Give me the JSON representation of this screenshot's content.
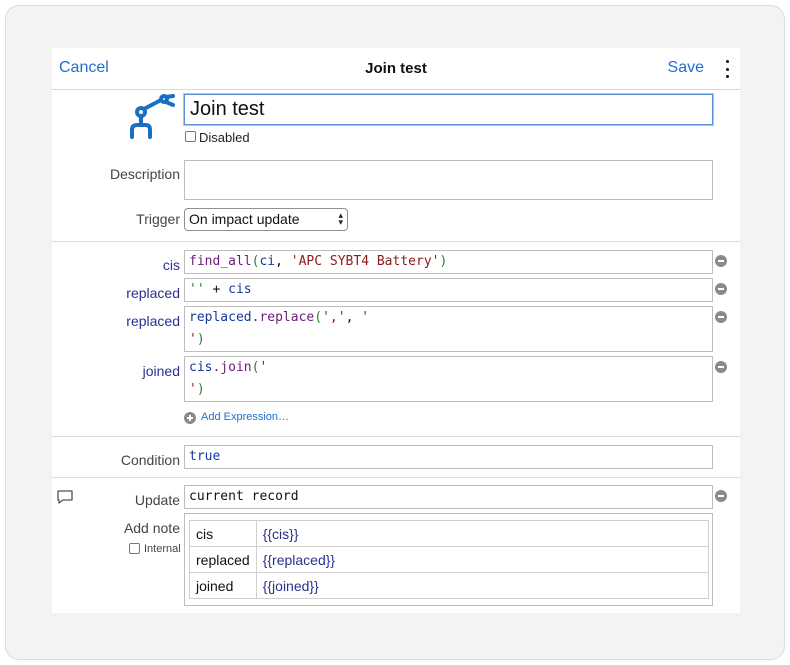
{
  "header": {
    "cancel_label": "Cancel",
    "title": "Join test",
    "save_label": "Save"
  },
  "identity": {
    "name_value": "Join test",
    "disabled_label": "Disabled"
  },
  "description": {
    "label": "Description",
    "value": ""
  },
  "trigger": {
    "label": "Trigger",
    "selected": "On impact update"
  },
  "expressions": [
    {
      "name": "cis"
    },
    {
      "name": "replaced"
    },
    {
      "name": "replaced"
    },
    {
      "name": "joined"
    }
  ],
  "code": {
    "e0_fn": "find_all",
    "e0_open": "(",
    "e0_var": "ci",
    "e0_comma": ", ",
    "e0_str": "'APC SYBT4 Battery'",
    "e0_close": ")",
    "e1_str": "''",
    "e1_op": " + ",
    "e1_var": "cis",
    "e2_var": "replaced",
    "e2_fn": ".replace",
    "e2_open": "(",
    "e2_str1": "','",
    "e2_comma": ", ",
    "e2_str2a": "'",
    "e2_str2b": "'",
    "e2_close": ")",
    "e3_var": "cis",
    "e3_fn": ".join",
    "e3_open": "(",
    "e3_str_a": "'",
    "e3_str_b": "'",
    "e3_close": ")"
  },
  "add_expression_label": "Add Expression…",
  "condition": {
    "label": "Condition",
    "value": "true"
  },
  "update": {
    "label": "Update",
    "value": "current record"
  },
  "note": {
    "label": "Add note",
    "internal_label": "Internal",
    "rows": [
      {
        "key": "cis",
        "value": "{{cis}}"
      },
      {
        "key": "replaced",
        "value": "{{replaced}}"
      },
      {
        "key": "joined",
        "value": "{{joined}}"
      }
    ]
  },
  "icons": {
    "robot_arm": "robot-arm-icon",
    "comment": "comment-icon",
    "remove": "minus-circle-icon",
    "add": "plus-circle-icon"
  },
  "colors": {
    "accent": "#1f6fd1",
    "robot": "#1a6fc0",
    "variable_label": "#2b2f8f"
  }
}
